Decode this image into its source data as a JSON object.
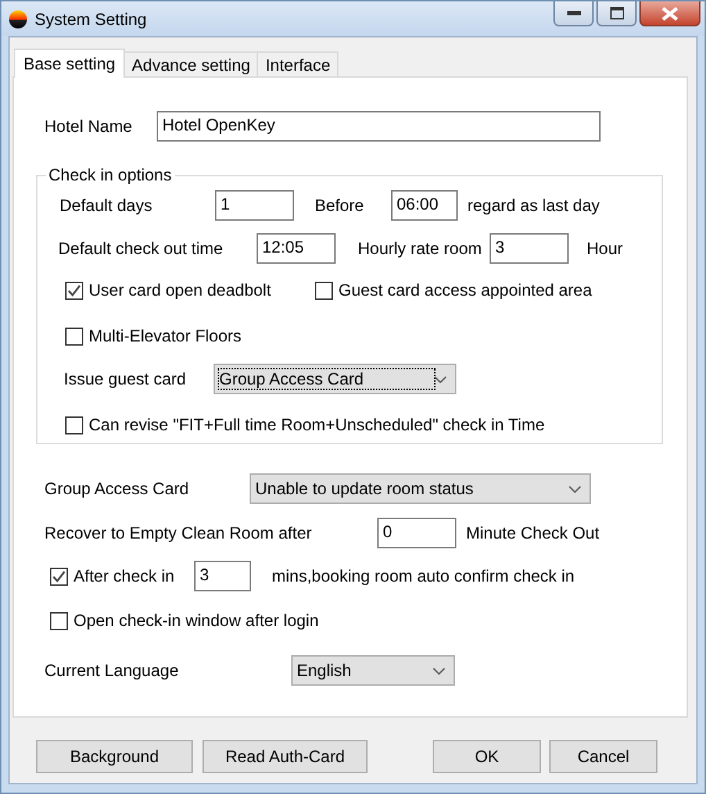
{
  "window": {
    "title": "System Setting"
  },
  "tabs": [
    {
      "label": "Base setting",
      "selected": true
    },
    {
      "label": "Advance setting",
      "selected": false
    },
    {
      "label": "Interface",
      "selected": false
    }
  ],
  "hotel_name": {
    "label": "Hotel Name",
    "value": "Hotel OpenKey"
  },
  "check_in_options": {
    "title": "Check in options",
    "default_days": {
      "label": "Default days",
      "value": "1"
    },
    "before": {
      "label": "Before",
      "value": "06:00",
      "suffix": "regard as last day"
    },
    "check_out_time": {
      "label": "Default check out time",
      "value": "12:05"
    },
    "hourly_rate_room": {
      "label": "Hourly rate room",
      "value": "3",
      "suffix": "Hour"
    },
    "user_card_open_deadbolt": {
      "label": "User card open deadbolt",
      "checked": true
    },
    "guest_card_access_area": {
      "label": "Guest card access appointed area",
      "checked": false
    },
    "multi_elevator_floors": {
      "label": "Multi-Elevator Floors",
      "checked": false
    },
    "issue_guest_card": {
      "label": "Issue guest card",
      "value": "Group Access Card"
    },
    "can_revise": {
      "label": "Can revise \"FIT+Full time Room+Unscheduled\" check in Time",
      "checked": false
    }
  },
  "group_access_card": {
    "label": "Group Access Card",
    "value": "Unable to update room status"
  },
  "recover": {
    "label": "Recover to Empty Clean Room after",
    "value": "0",
    "suffix": "Minute Check Out"
  },
  "after_check_in": {
    "label": "After check in",
    "checked": true,
    "value": "3",
    "suffix": "mins,booking room auto confirm check in"
  },
  "open_check_in_window": {
    "label": "Open check-in window after login",
    "checked": false
  },
  "current_language": {
    "label": "Current Language",
    "value": "English"
  },
  "buttons": [
    "Background",
    "Read Auth-Card",
    "OK",
    "Cancel"
  ]
}
